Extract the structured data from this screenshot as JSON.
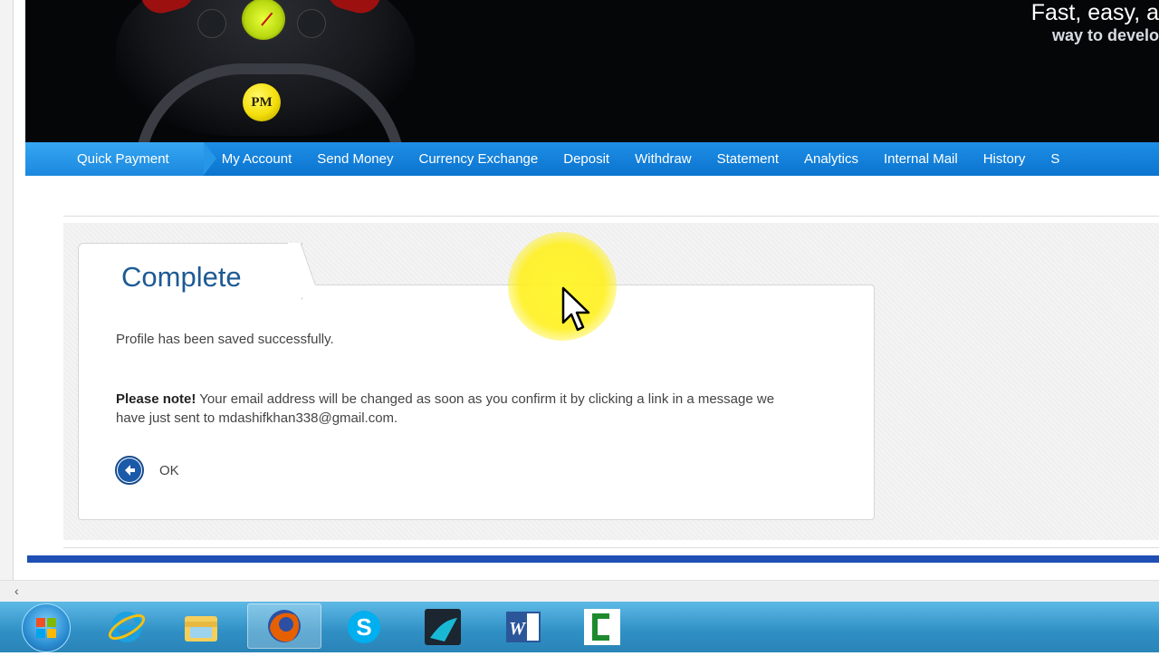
{
  "banner": {
    "logo_text": "PM",
    "tagline_line1": "Fast, easy, a",
    "tagline_line2": "way to develo"
  },
  "nav": {
    "items": [
      {
        "label": "Quick Payment",
        "active": true
      },
      {
        "label": "My Account"
      },
      {
        "label": "Send Money"
      },
      {
        "label": "Currency Exchange"
      },
      {
        "label": "Deposit"
      },
      {
        "label": "Withdraw"
      },
      {
        "label": "Statement"
      },
      {
        "label": "Analytics"
      },
      {
        "label": "Internal Mail"
      },
      {
        "label": "History"
      },
      {
        "label": "S"
      }
    ]
  },
  "panel": {
    "title": "Complete",
    "saved_message": "Profile has been saved successfully.",
    "note_label": "Please note!",
    "note_text": " Your email address will be changed as soon as you confirm it by clicking a link in a message we have just sent to mdashifkhan338@gmail.com.",
    "ok_label": "OK"
  },
  "taskbar": {
    "apps": [
      "internet-explorer-icon",
      "file-explorer-icon",
      "firefox-icon",
      "skype-icon",
      "app-icon",
      "word-icon",
      "camtasia-icon"
    ]
  },
  "colors": {
    "nav_blue": "#0b74cf",
    "title_blue": "#1d5a94",
    "bottom_bar": "#1f4fb5",
    "cursor_halo": "#fff528"
  }
}
